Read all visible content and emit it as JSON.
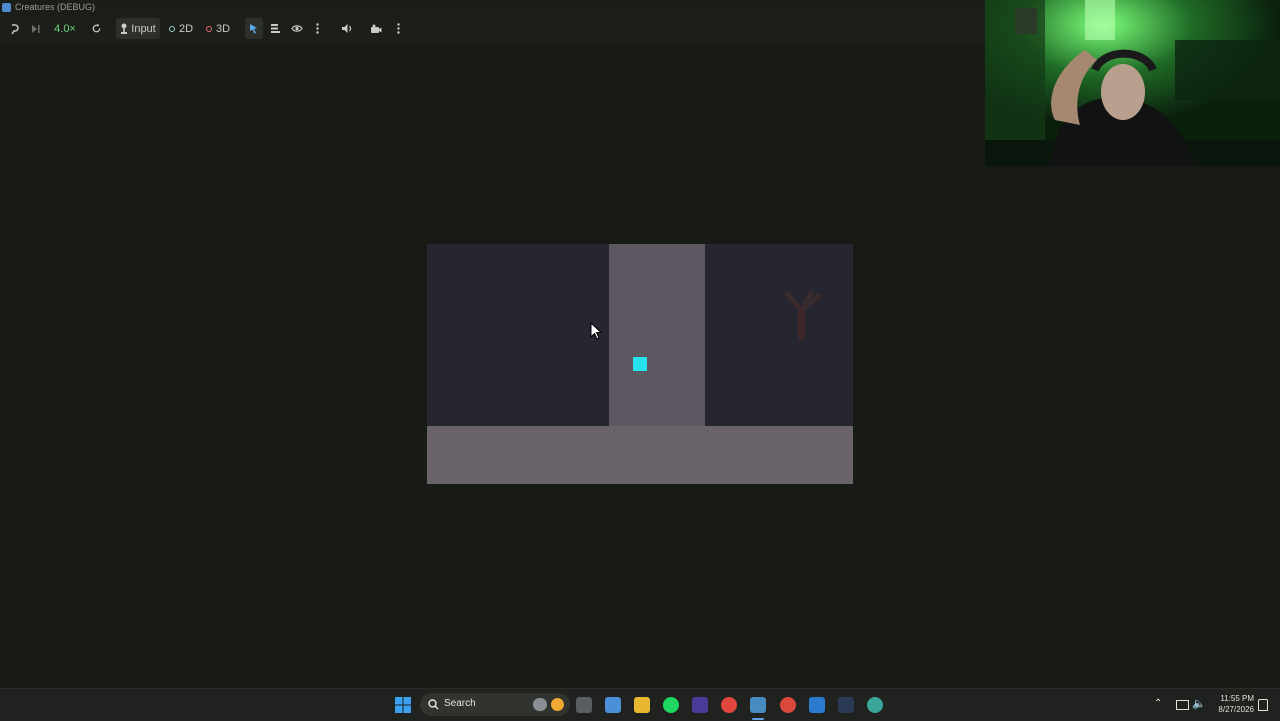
{
  "window": {
    "title": "Creatures (DEBUG)"
  },
  "toolbar": {
    "speed": "4.0×",
    "input_label": "Input",
    "mode_2d": "2D",
    "mode_3d": "3D"
  },
  "taskbar": {
    "search_label": "Search",
    "time": "11:55 PM",
    "date": "8/27/2026",
    "pinned_apps": [
      "windows-start",
      "search",
      "task-view",
      "file-explorer",
      "notepad",
      "folder",
      "spotify",
      "hudfx",
      "chrome",
      "godot",
      "chrome-alt",
      "vscode",
      "steam",
      "browser"
    ]
  },
  "colors": {
    "background": "#181a15",
    "game_sky": "#25262f",
    "pillar": "#5c5760",
    "floor": "#6a6369",
    "player": "#25e3ea",
    "speed_text": "#6fd37b"
  }
}
